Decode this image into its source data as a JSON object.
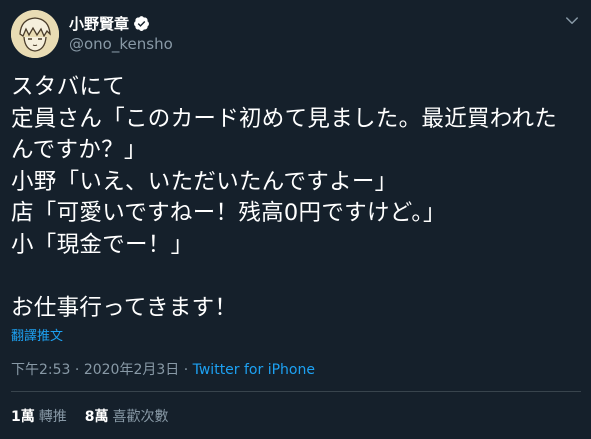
{
  "author": {
    "display_name": "小野賢章",
    "handle": "@ono_kensho",
    "verified": true
  },
  "icons": {
    "verified": "verified-badge-icon",
    "menu": "chevron-down-icon"
  },
  "tweet": {
    "lines": [
      "スタバにて",
      "定員さん「このカード初めて見ました。最近買われた",
      "んですか？」",
      "小野「いえ、いただいたんですよー」",
      "店「可愛いですねー！残高0円ですけど。」",
      "小「現金でー！」",
      "",
      "お仕事行ってきます！"
    ],
    "translate_label": "翻譯推文",
    "time": "下午2:53",
    "date": "2020年2月3日",
    "separator": "·",
    "source": "Twitter for iPhone"
  },
  "stats": {
    "retweets_count": "1萬",
    "retweets_label": "轉推",
    "likes_count": "8萬",
    "likes_label": "喜歡次數"
  },
  "colors": {
    "background": "#15202b",
    "text": "#ffffff",
    "secondary": "#8899a6",
    "accent": "#1da1f2",
    "divider": "#38444d"
  }
}
